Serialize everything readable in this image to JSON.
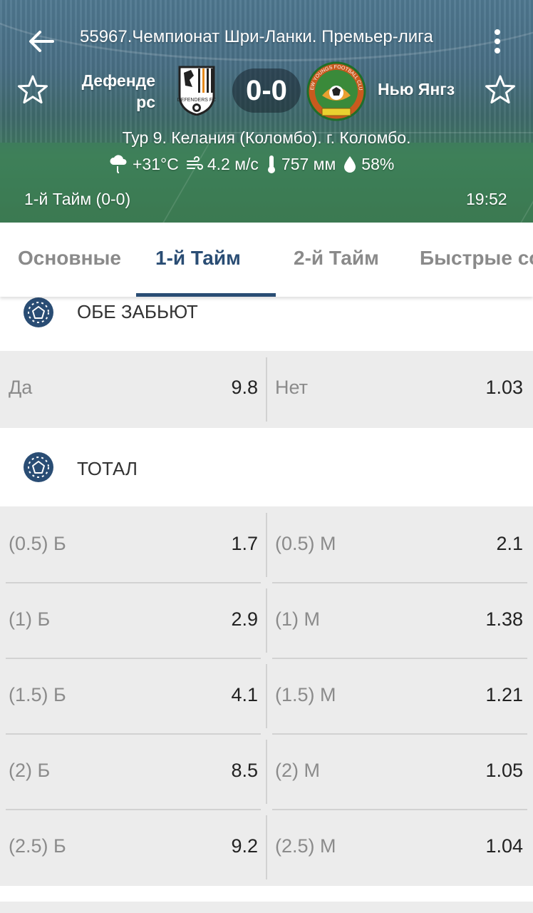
{
  "header": {
    "title": "55967.Чемпионат Шри-Ланки. Премьер-лига",
    "home_team": "Дефенде рс",
    "away_team": "Нью Янгз",
    "home_logo_text": "DEFENDERS FC",
    "away_logo_text": "NEW YOUNGS FOOTBALL CLUB",
    "score": "0-0",
    "venue": "Тур 9. Келания (Коломбо). г. Коломбо.",
    "weather": {
      "temperature": "+31°C",
      "wind": "4.2 м/с",
      "pressure": "757 мм",
      "humidity": "58%"
    },
    "period": "1-й  Тайм (0-0)",
    "clock": "19:52"
  },
  "tabs": [
    {
      "label": "Основные"
    },
    {
      "label": "1-й  Тайм"
    },
    {
      "label": "2-й  Тайм"
    },
    {
      "label": "Быстрые со"
    }
  ],
  "active_tab": "1-й  Тайм",
  "markets": {
    "both_score": {
      "title": "ОБЕ ЗАБЬЮТ",
      "yes_label": "Да",
      "yes_odd": "9.8",
      "no_label": "Нет",
      "no_odd": "1.03"
    },
    "total": {
      "title": "ТОТАЛ",
      "rows": [
        {
          "over_label": "(0.5) Б",
          "over_odd": "1.7",
          "under_label": "(0.5) М",
          "under_odd": "2.1"
        },
        {
          "over_label": "(1) Б",
          "over_odd": "2.9",
          "under_label": "(1) М",
          "under_odd": "1.38"
        },
        {
          "over_label": "(1.5) Б",
          "over_odd": "4.1",
          "under_label": "(1.5) М",
          "under_odd": "1.21"
        },
        {
          "over_label": "(2) Б",
          "over_odd": "8.5",
          "under_label": "(2) М",
          "under_odd": "1.05"
        },
        {
          "over_label": "(2.5) Б",
          "over_odd": "9.2",
          "under_label": "(2.5) М",
          "under_odd": "1.04"
        }
      ]
    }
  },
  "colors": {
    "accent": "#2a4d74",
    "odds_background": "#ececec",
    "separator": "#d2d2d2"
  }
}
